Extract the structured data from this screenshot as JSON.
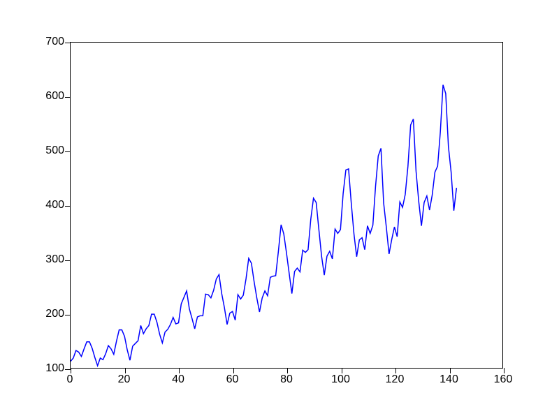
{
  "chart_data": {
    "type": "line",
    "title": "",
    "xlabel": "",
    "ylabel": "",
    "xlim": [
      0,
      160
    ],
    "ylim": [
      100,
      700
    ],
    "x_ticks": [
      0,
      20,
      40,
      60,
      80,
      100,
      120,
      140,
      160
    ],
    "y_ticks": [
      100,
      200,
      300,
      400,
      500,
      600,
      700
    ],
    "line_color": "#0000ff",
    "x": [
      0,
      1,
      2,
      3,
      4,
      5,
      6,
      7,
      8,
      9,
      10,
      11,
      12,
      13,
      14,
      15,
      16,
      17,
      18,
      19,
      20,
      21,
      22,
      23,
      24,
      25,
      26,
      27,
      28,
      29,
      30,
      31,
      32,
      33,
      34,
      35,
      36,
      37,
      38,
      39,
      40,
      41,
      42,
      43,
      44,
      45,
      46,
      47,
      48,
      49,
      50,
      51,
      52,
      53,
      54,
      55,
      56,
      57,
      58,
      59,
      60,
      61,
      62,
      63,
      64,
      65,
      66,
      67,
      68,
      69,
      70,
      71,
      72,
      73,
      74,
      75,
      76,
      77,
      78,
      79,
      80,
      81,
      82,
      83,
      84,
      85,
      86,
      87,
      88,
      89,
      90,
      91,
      92,
      93,
      94,
      95,
      96,
      97,
      98,
      99,
      100,
      101,
      102,
      103,
      104,
      105,
      106,
      107,
      108,
      109,
      110,
      111,
      112,
      113,
      114,
      115,
      116,
      117,
      118,
      119,
      120,
      121,
      122,
      123,
      124,
      125,
      126,
      127,
      128,
      129,
      130,
      131,
      132,
      133,
      134,
      135,
      136,
      137,
      138,
      139,
      140,
      141,
      142,
      143
    ],
    "values": [
      112,
      118,
      132,
      129,
      121,
      135,
      148,
      148,
      136,
      119,
      104,
      118,
      115,
      126,
      141,
      135,
      125,
      149,
      170,
      170,
      158,
      133,
      114,
      140,
      145,
      150,
      178,
      163,
      172,
      178,
      199,
      199,
      184,
      162,
      146,
      166,
      171,
      180,
      193,
      181,
      183,
      218,
      230,
      242,
      209,
      191,
      172,
      194,
      196,
      196,
      236,
      235,
      229,
      243,
      264,
      272,
      237,
      211,
      180,
      201,
      204,
      188,
      235,
      227,
      234,
      264,
      302,
      293,
      259,
      229,
      203,
      229,
      242,
      233,
      267,
      269,
      270,
      315,
      364,
      347,
      312,
      274,
      237,
      278,
      284,
      277,
      317,
      313,
      318,
      374,
      413,
      405,
      355,
      306,
      271,
      306,
      315,
      301,
      356,
      348,
      355,
      422,
      465,
      467,
      404,
      347,
      305,
      336,
      340,
      318,
      362,
      348,
      363,
      435,
      491,
      505,
      404,
      359,
      310,
      337,
      360,
      342,
      406,
      396,
      420,
      472,
      548,
      559,
      463,
      407,
      362,
      405,
      417,
      391,
      419,
      461,
      472,
      535,
      622,
      606,
      508,
      461,
      390,
      432
    ]
  }
}
